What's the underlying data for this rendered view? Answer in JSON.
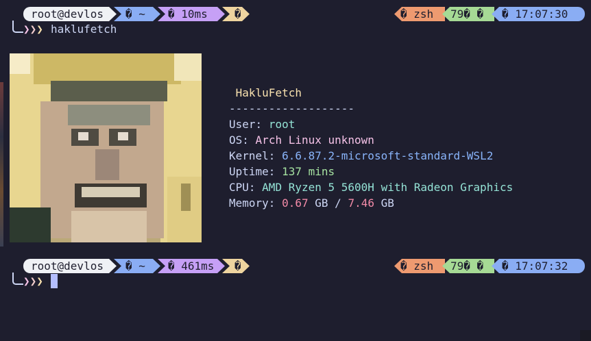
{
  "prompt1": {
    "user_host": "root@devlos",
    "dir": "� ~",
    "duration": "� 10ms",
    "git": "�",
    "shell": "� zsh",
    "code": "79� �",
    "clock": "� 17:07:30",
    "arrow": [
      "❯",
      "❯",
      "❯"
    ],
    "command": "haklufetch"
  },
  "fetch": {
    "title": "HakluFetch",
    "separator": "-------------------",
    "rows": [
      {
        "label": "User:",
        "value": "root"
      },
      {
        "label": "OS:",
        "value": "Arch Linux unknown"
      },
      {
        "label": "Kernel:",
        "value": "6.6.87.2-microsoft-standard-WSL2"
      },
      {
        "label": "Uptime:",
        "value": "137 mins"
      },
      {
        "label": "CPU:",
        "value": "AMD Ryzen 5 5600H with Radeon Graphics"
      }
    ],
    "memory": {
      "label": "Memory:",
      "used": "0.67",
      "unit1": "GB",
      "sep": "/",
      "total": "7.46",
      "unit2": "GB"
    }
  },
  "prompt2": {
    "user_host": "root@devlos",
    "dir": "� ~",
    "duration": "� 461ms",
    "git": "�",
    "shell": "� zsh",
    "code": "79� �",
    "clock": "� 17:07:32",
    "arrow": [
      "❯",
      "❯",
      "❯"
    ]
  },
  "colors": {
    "background": "#1e1e2e",
    "foreground": "#cdd6f4",
    "segment_user": "#eff1f5",
    "segment_dir": "#8aadf4",
    "segment_duration": "#c6a0f6",
    "segment_git": "#eed49f",
    "segment_shell": "#ee9a70",
    "segment_code": "#a6da95",
    "segment_clock": "#8aadf4"
  }
}
